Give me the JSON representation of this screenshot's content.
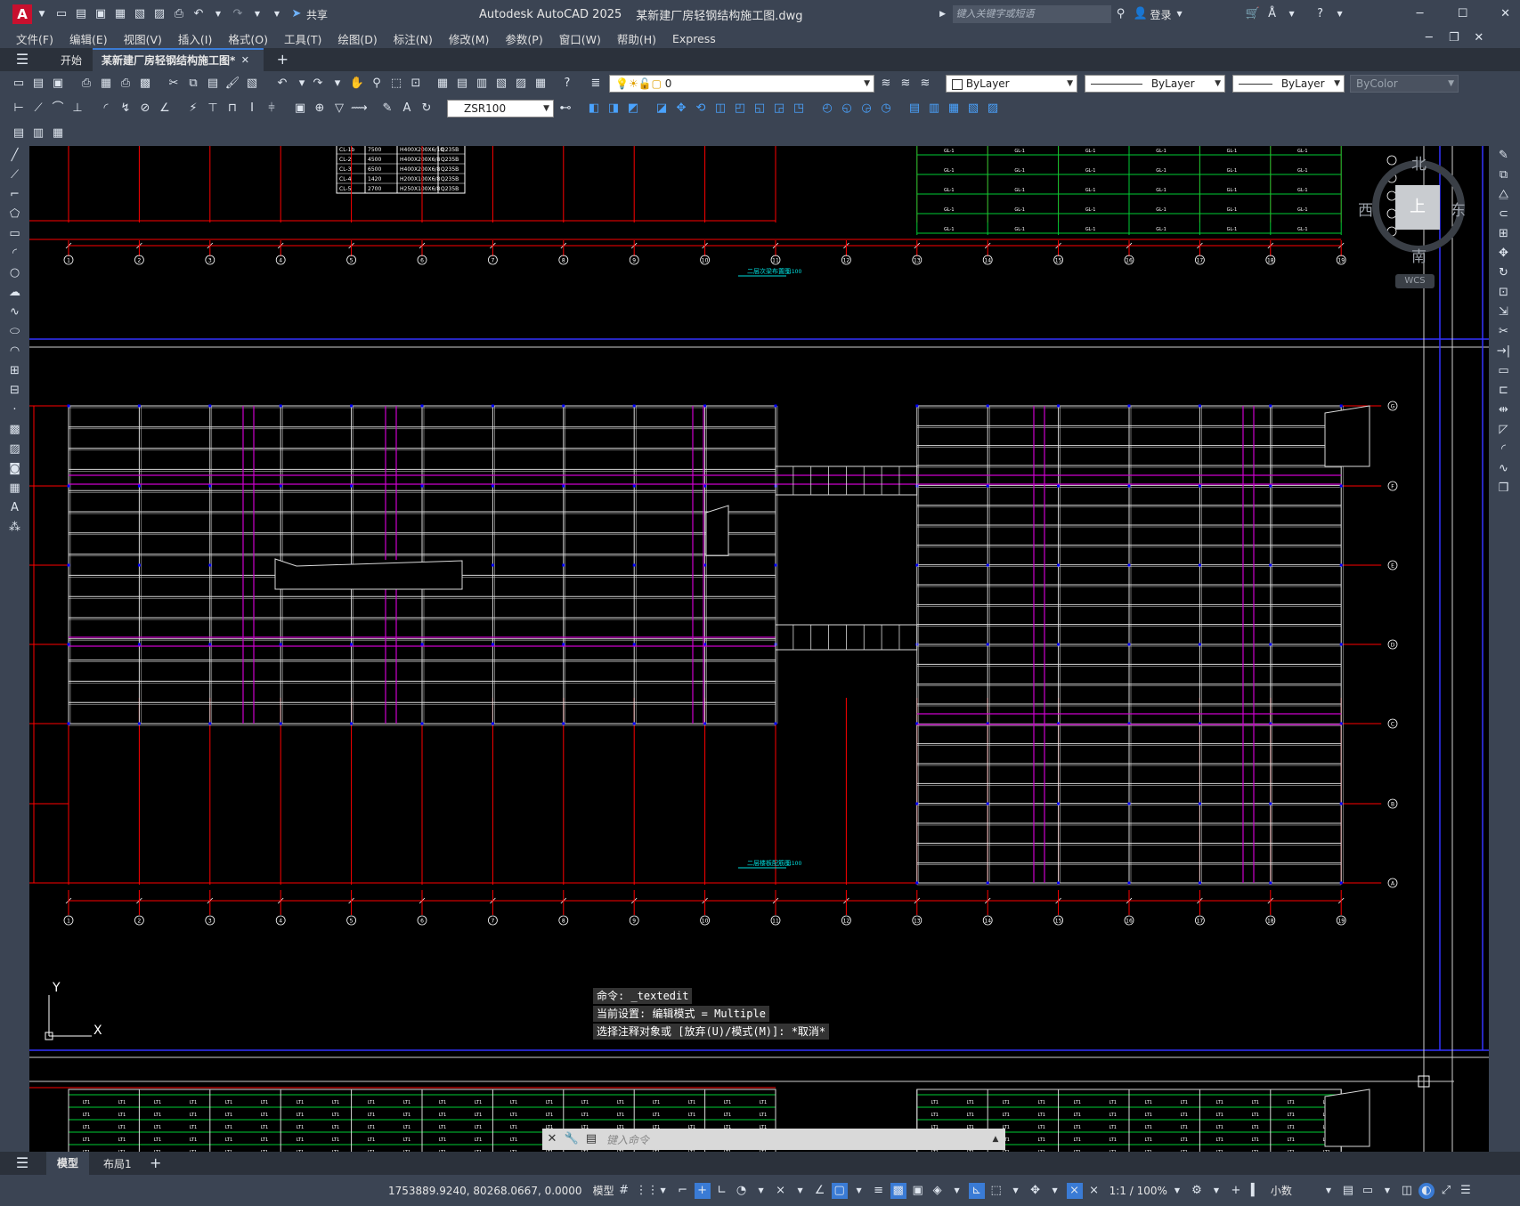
{
  "titlebar": {
    "logo": "A",
    "share_label": "共享",
    "app_title": "Autodesk AutoCAD 2025",
    "file_name": "某新建厂房轻钢结构施工图.dwg",
    "search_placeholder": "键入关键字或短语",
    "login_label": "登录"
  },
  "menu": [
    "文件(F)",
    "编辑(E)",
    "视图(V)",
    "插入(I)",
    "格式(O)",
    "工具(T)",
    "绘图(D)",
    "标注(N)",
    "修改(M)",
    "参数(P)",
    "窗口(W)",
    "帮助(H)",
    "Express"
  ],
  "tabs": {
    "start": "开始",
    "active": "某新建厂房轻钢结构施工图*"
  },
  "toolbar": {
    "layer_value": "0",
    "color_value": "ByLayer",
    "linetype_value": "ByLayer",
    "lineweight_value": "ByLayer",
    "plotstyle_value": "ByColor",
    "dimstyle_value": "ZSR100"
  },
  "viewcube": {
    "north": "北",
    "south": "南",
    "east": "东",
    "west": "西",
    "top": "上",
    "wcs": "WCS"
  },
  "drawing": {
    "schedule_rows": [
      [
        "CL-1b",
        "7500",
        "H400X200X6/10",
        "Q235B"
      ],
      [
        "CL-2",
        "4500",
        "H400X200X6/8",
        "Q235B"
      ],
      [
        "CL-3",
        "6500",
        "H400X200X6/8",
        "Q235B"
      ],
      [
        "CL-4",
        "1420",
        "H200X100X6/8",
        "Q235B"
      ],
      [
        "CL-5",
        "2700",
        "H250X100X6/8",
        "Q235B"
      ]
    ],
    "axis_labels": [
      "1",
      "2",
      "3",
      "4",
      "5",
      "6",
      "7",
      "8",
      "9",
      "10",
      "11",
      "12",
      "13",
      "14",
      "15",
      "16",
      "17",
      "18",
      "19"
    ],
    "row_labels": [
      "G",
      "F",
      "E",
      "D",
      "C",
      "B",
      "A"
    ],
    "title_top": "二层次梁布置图",
    "title_mid": "二层楼板配筋图",
    "scale": "1:100",
    "ucs_y": "Y",
    "ucs_x": "X"
  },
  "command": {
    "history": [
      "命令: _textedit",
      "当前设置: 编辑模式 = Multiple",
      "选择注释对象或 [放弃(U)/模式(M)]: *取消*"
    ],
    "placeholder": "键入命令"
  },
  "layout_tabs": {
    "model": "模型",
    "layout1": "布局1"
  },
  "status": {
    "coords": "1753889.9240, 80268.0667, 0.0000",
    "model_label": "模型",
    "scale": "1:1 / 100%",
    "units": "小数"
  },
  "colors": {
    "accent": "#3a7bd5",
    "chrome": "#3b4453",
    "grid_red": "#ff0000",
    "magenta": "#cc00cc",
    "green": "#00cc33",
    "blue": "#0000ff"
  }
}
